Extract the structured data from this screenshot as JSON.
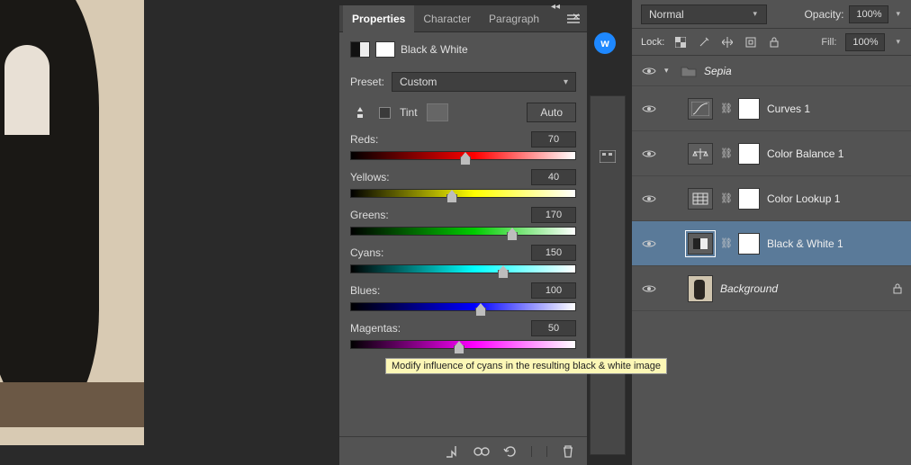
{
  "panel": {
    "tabs": {
      "properties": "Properties",
      "character": "Character",
      "paragraph": "Paragraph"
    },
    "adjustment_title": "Black & White",
    "preset_label": "Preset:",
    "preset_value": "Custom",
    "tint_label": "Tint",
    "auto_label": "Auto",
    "sliders": [
      {
        "label": "Reds:",
        "value": "70",
        "pct": 51,
        "grad": "grad-red"
      },
      {
        "label": "Yellows:",
        "value": "40",
        "pct": 45,
        "grad": "grad-yellow"
      },
      {
        "label": "Greens:",
        "value": "170",
        "pct": 72,
        "grad": "grad-green"
      },
      {
        "label": "Cyans:",
        "value": "150",
        "pct": 68,
        "grad": "grad-cyan"
      },
      {
        "label": "Blues:",
        "value": "100",
        "pct": 58,
        "grad": "grad-blue"
      },
      {
        "label": "Magentas:",
        "value": "50",
        "pct": 48,
        "grad": "grad-magenta"
      }
    ]
  },
  "tooltip": "Modify influence of cyans in the resulting black & white image",
  "layers": {
    "blend_mode": "Normal",
    "opacity_label": "Opacity:",
    "opacity_value": "100%",
    "lock_label": "Lock:",
    "fill_label": "Fill:",
    "fill_value": "100%",
    "group_name": "Sepia",
    "items": [
      {
        "name": "Curves 1",
        "icon": "curves"
      },
      {
        "name": "Color Balance 1",
        "icon": "balance"
      },
      {
        "name": "Color Lookup 1",
        "icon": "lookup"
      },
      {
        "name": "Black & White 1",
        "icon": "bw",
        "selected": true
      }
    ],
    "background_name": "Background"
  },
  "w_badge": "w"
}
